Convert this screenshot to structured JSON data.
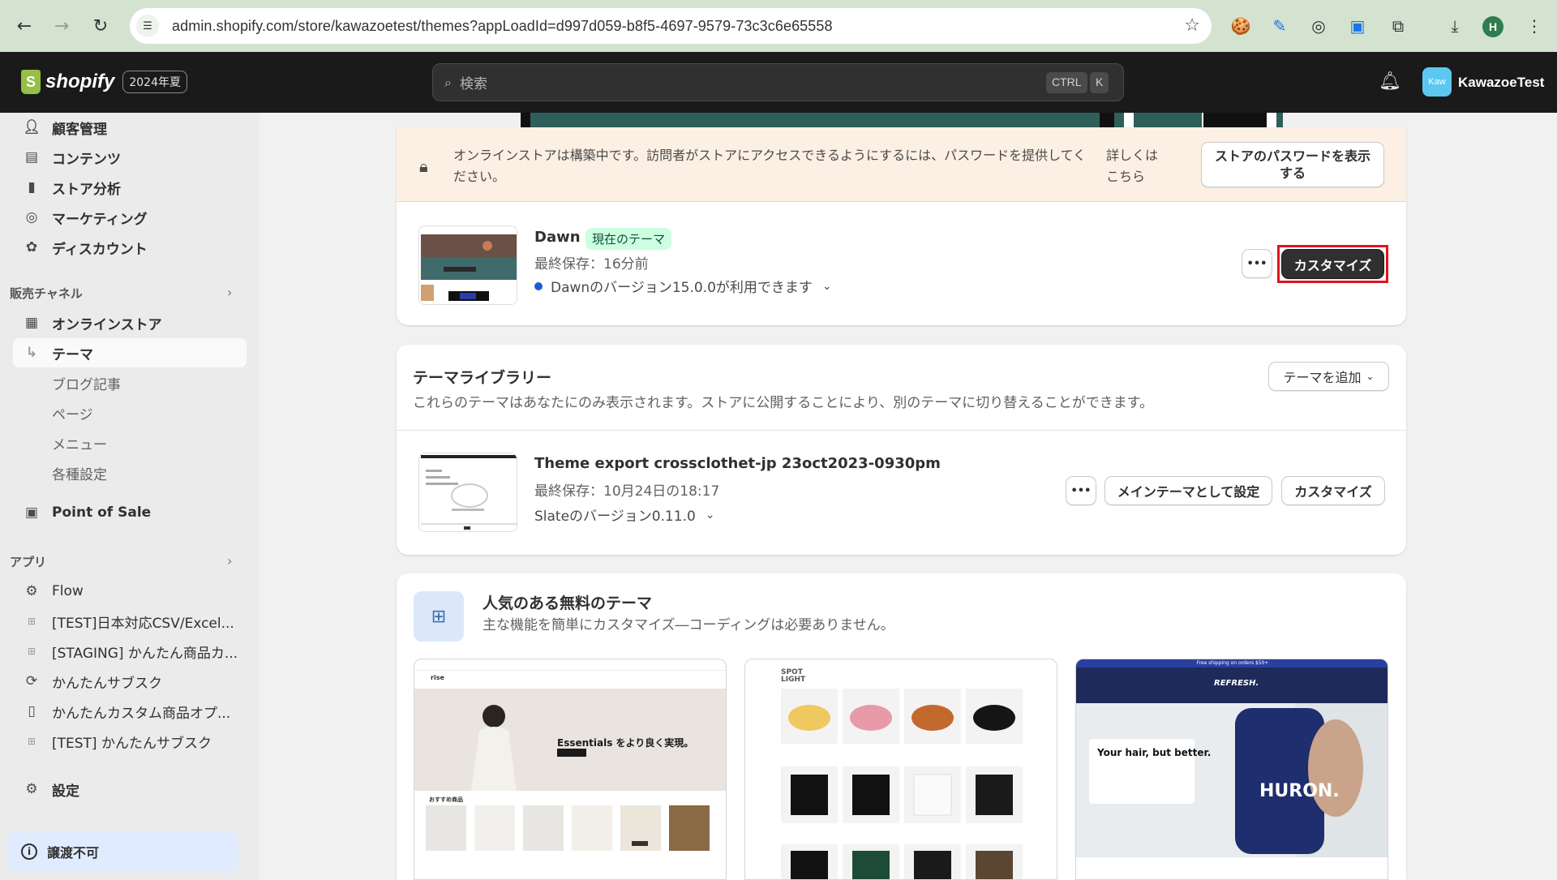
{
  "browser": {
    "url": "admin.shopify.com/store/kawazoetest/themes?appLoadId=d997d059-b8f5-4697-9579-73c3c6e65558",
    "profile_initial": "H"
  },
  "topbar": {
    "logo_text": "shopify",
    "edition_badge": "2024年夏",
    "search_placeholder": "検索",
    "shortcut_ctrl": "CTRL",
    "shortcut_key": "K",
    "avatar_text": "Kaw",
    "user_name": "KawazoeTest"
  },
  "sidebar": {
    "items_top": [
      "顧客管理",
      "コンテンツ",
      "ストア分析",
      "マーケティング",
      "ディスカウント"
    ],
    "sales_channels_heading": "販売チャネル",
    "online_store": "オンラインストア",
    "theme": "テーマ",
    "sub_items": [
      "ブログ記事",
      "ページ",
      "メニュー",
      "各種設定"
    ],
    "pos": "Point of Sale",
    "apps_heading": "アプリ",
    "apps": [
      "Flow",
      "[TEST]日本対応CSV/Excel...",
      "[STAGING] かんたん商品カ...",
      "かんたんサブスク",
      "かんたんカスタム商品オプ...",
      "[TEST] かんたんサブスク"
    ],
    "settings": "設定",
    "bottom_notice": "譲渡不可"
  },
  "banner": {
    "message": "オンラインストアは構築中です。訪問者がストアにアクセスできるようにするには、パスワードを提供してください。",
    "more_link": "詳しくはこちら",
    "button": "ストアのパスワードを表示する"
  },
  "current_theme": {
    "name": "Dawn",
    "badge": "現在のテーマ",
    "saved": "最終保存：16分前",
    "update_notice": "Dawnのバージョン15.0.0が利用できます",
    "more_button": "•••",
    "customize_button": "カスタマイズ",
    "accent_highlight": "#e0141e"
  },
  "library": {
    "title": "テーマライブラリー",
    "subtitle": "これらのテーマはあなたにのみ表示されます。ストアに公開することにより、別のテーマに切り替えることができます。",
    "add_button": "テーマを追加",
    "theme_name": "Theme export crossclothet-jp 23oct2023-0930pm",
    "saved": "最終保存：10月24日の18:17",
    "version": "Slateのバージョン0.11.0",
    "more_button": "•••",
    "publish_button": "メインテーマとして設定",
    "customize_button": "カスタマイズ"
  },
  "free_themes": {
    "title": "人気のある無料のテーマ",
    "subtitle": "主な機能を簡単にカスタマイズ―コーディングは必要ありません。",
    "previews": [
      {
        "brand": "rise",
        "headline": "Essentials をより良く実現。",
        "section": "おすすめ商品"
      },
      {
        "brand": "SPOT LIGHT"
      },
      {
        "brand": "REFRESH.",
        "banner": "Free shipping on orders $50+",
        "headline": "Your hair, but better.",
        "product": "HURON."
      }
    ]
  }
}
